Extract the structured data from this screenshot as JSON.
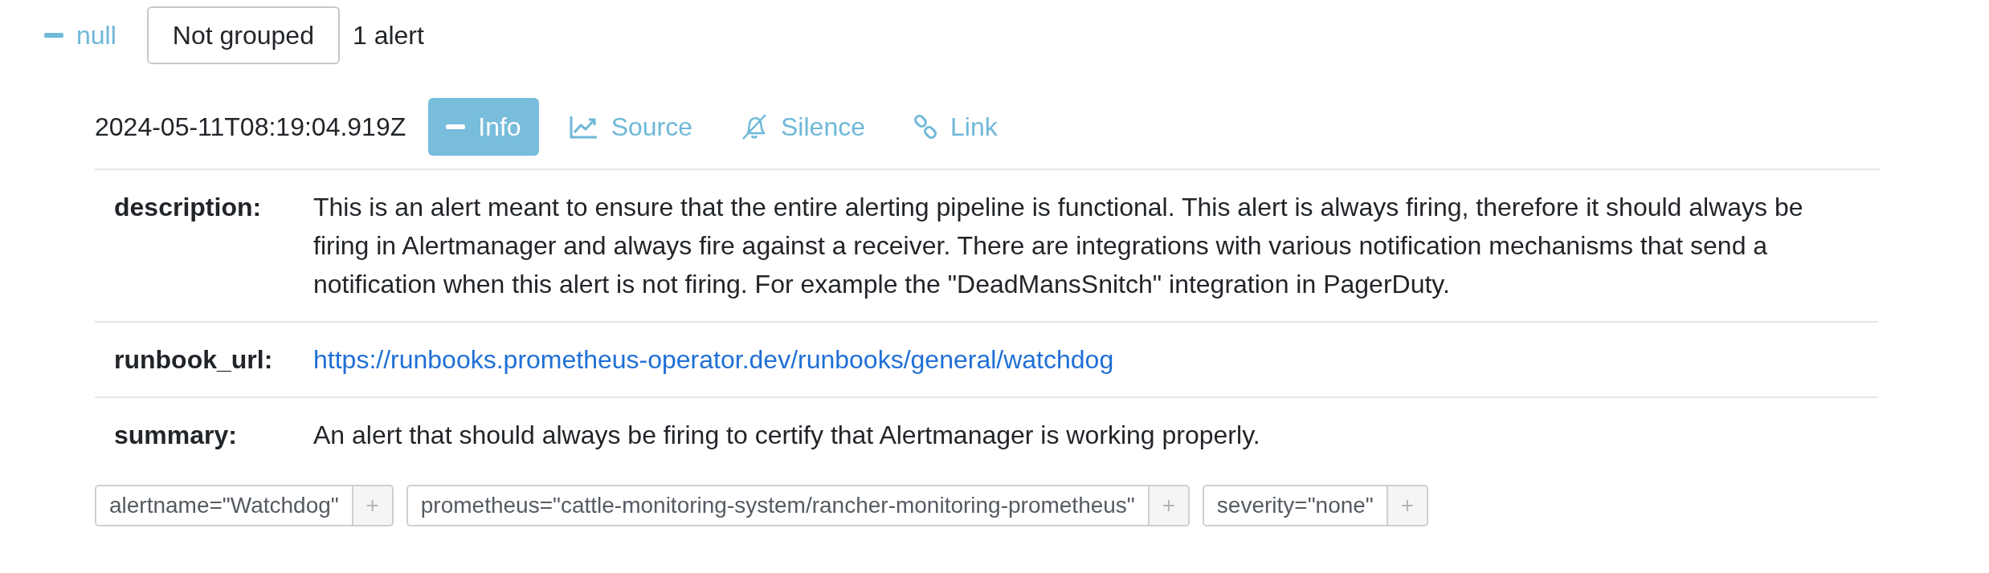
{
  "group": {
    "expanded": true,
    "title": "null",
    "grouping": "Not grouped",
    "count": "1 alert"
  },
  "alert": {
    "timestamp": "2024-05-11T08:19:04.919Z",
    "actions": [
      {
        "kind": "info",
        "label": "Info",
        "selected": true
      },
      {
        "kind": "source",
        "label": "Source",
        "selected": false
      },
      {
        "kind": "silence",
        "label": "Silence",
        "selected": false
      },
      {
        "kind": "link",
        "label": "Link",
        "selected": false
      }
    ],
    "annotations": [
      {
        "kind": "text",
        "key": "description:",
        "value": "This is an alert meant to ensure that the entire alerting pipeline is functional. This alert is always firing, therefore it should always be firing in Alertmanager and always fire against a receiver. There are integrations with various notification mechanisms that send a notification when this alert is not firing. For example the \"DeadMansSnitch\" integration in PagerDuty."
      },
      {
        "kind": "link",
        "key": "runbook_url:",
        "value": "https://runbooks.prometheus-operator.dev/runbooks/general/watchdog"
      },
      {
        "kind": "text",
        "key": "summary:",
        "value": "An alert that should always be firing to certify that Alertmanager is working properly."
      }
    ],
    "labels": [
      {
        "text": "alertname=\"Watchdog\"",
        "add": "+"
      },
      {
        "text": "prometheus=\"cattle-monitoring-system/rancher-monitoring-prometheus\"",
        "add": "+"
      },
      {
        "text": "severity=\"none\"",
        "add": "+"
      }
    ]
  }
}
